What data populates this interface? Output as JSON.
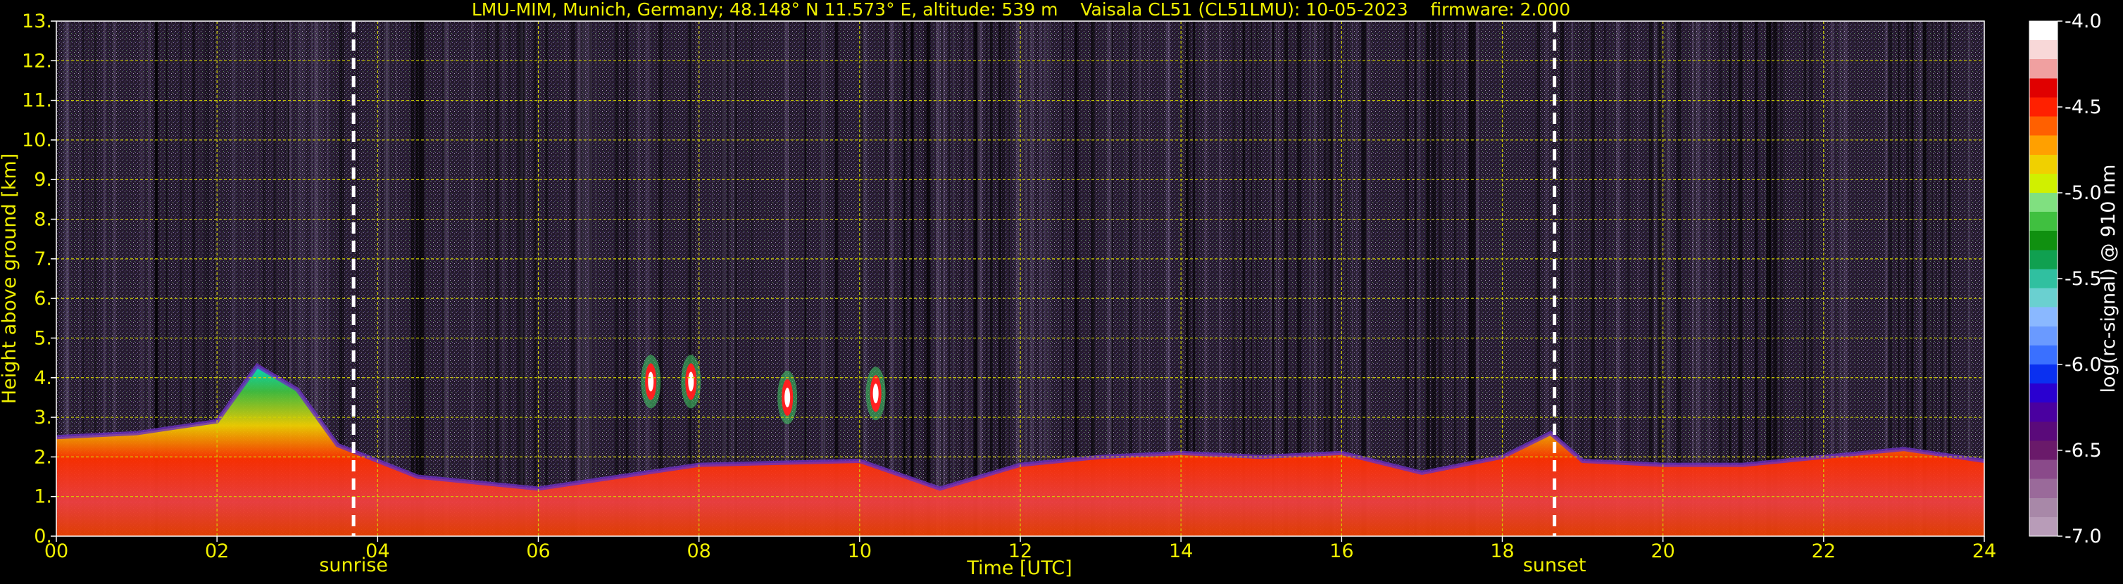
{
  "chart_data": {
    "type": "heatmap",
    "title": "LMU-MIM, Munich, Germany; 48.148° N 11.573° E, altitude: 539 m    Vaisala CL51 (CL51LMU): 10-05-2023    firmware: 2.000",
    "xlabel": "Time [UTC]",
    "ylabel": "Height above ground [km]",
    "xlim": [
      0,
      24
    ],
    "ylim": [
      0,
      13
    ],
    "x_ticks": [
      {
        "value": 0,
        "label": "00"
      },
      {
        "value": 2,
        "label": "02"
      },
      {
        "value": 4,
        "label": "04"
      },
      {
        "value": 6,
        "label": "06"
      },
      {
        "value": 8,
        "label": "08"
      },
      {
        "value": 10,
        "label": "10"
      },
      {
        "value": 12,
        "label": "12"
      },
      {
        "value": 14,
        "label": "14"
      },
      {
        "value": 16,
        "label": "16"
      },
      {
        "value": 18,
        "label": "18"
      },
      {
        "value": 20,
        "label": "20"
      },
      {
        "value": 22,
        "label": "22"
      },
      {
        "value": 24,
        "label": "24"
      }
    ],
    "y_ticks": [
      {
        "value": 0,
        "label": "0."
      },
      {
        "value": 1,
        "label": "1."
      },
      {
        "value": 2,
        "label": "2."
      },
      {
        "value": 3,
        "label": "3."
      },
      {
        "value": 4,
        "label": "4."
      },
      {
        "value": 5,
        "label": "5."
      },
      {
        "value": 6,
        "label": "6."
      },
      {
        "value": 7,
        "label": "7."
      },
      {
        "value": 8,
        "label": "8."
      },
      {
        "value": 9,
        "label": "9."
      },
      {
        "value": 10,
        "label": "10."
      },
      {
        "value": 11,
        "label": "11."
      },
      {
        "value": 12,
        "label": "12."
      },
      {
        "value": 13,
        "label": "13."
      }
    ],
    "grid": true,
    "grid_color": "#d4d400",
    "vlines": [
      {
        "x": 3.7,
        "label": "sunrise"
      },
      {
        "x": 18.65,
        "label": "sunset"
      }
    ],
    "colorbar": {
      "label": "log(rc-signal) @ 910 nm",
      "range": [
        -7.0,
        -4.0
      ],
      "ticks": [
        {
          "value": -4.0,
          "label": "-4.0"
        },
        {
          "value": -4.5,
          "label": "-4.5"
        },
        {
          "value": -5.0,
          "label": "-5.0"
        },
        {
          "value": -5.5,
          "label": "-5.5"
        },
        {
          "value": -6.0,
          "label": "-6.0"
        },
        {
          "value": -6.5,
          "label": "-6.5"
        },
        {
          "value": -7.0,
          "label": "-7.0"
        }
      ],
      "colors": [
        "#b89cb8",
        "#a888a8",
        "#9a6a9a",
        "#8a4a8a",
        "#6a1a6a",
        "#5a0a7a",
        "#4a00a0",
        "#2a00d0",
        "#0a30f0",
        "#3a70ff",
        "#6a9aff",
        "#8ab8ff",
        "#6ad0d0",
        "#30c0a0",
        "#10a050",
        "#109010",
        "#40c040",
        "#80e080",
        "#d0f000",
        "#f0d000",
        "#ffa000",
        "#ff6000",
        "#ff2000",
        "#e00000",
        "#f0a0a0",
        "#f8d8d8",
        "#ffffff"
      ]
    },
    "aerosol_layer_top": [
      {
        "x": 0.0,
        "y": 2.5
      },
      {
        "x": 1.0,
        "y": 2.6
      },
      {
        "x": 2.0,
        "y": 2.9
      },
      {
        "x": 2.5,
        "y": 4.3
      },
      {
        "x": 3.0,
        "y": 3.7
      },
      {
        "x": 3.5,
        "y": 2.3
      },
      {
        "x": 4.5,
        "y": 1.5
      },
      {
        "x": 6.0,
        "y": 1.2
      },
      {
        "x": 8.0,
        "y": 1.8
      },
      {
        "x": 10.0,
        "y": 1.9
      },
      {
        "x": 11.0,
        "y": 1.2
      },
      {
        "x": 12.0,
        "y": 1.8
      },
      {
        "x": 13.0,
        "y": 2.0
      },
      {
        "x": 14.0,
        "y": 2.1
      },
      {
        "x": 15.0,
        "y": 2.0
      },
      {
        "x": 16.0,
        "y": 2.1
      },
      {
        "x": 17.0,
        "y": 1.6
      },
      {
        "x": 18.0,
        "y": 2.0
      },
      {
        "x": 18.6,
        "y": 2.6
      },
      {
        "x": 19.0,
        "y": 1.9
      },
      {
        "x": 20.0,
        "y": 1.8
      },
      {
        "x": 21.0,
        "y": 1.8
      },
      {
        "x": 22.0,
        "y": 2.0
      },
      {
        "x": 23.0,
        "y": 2.2
      },
      {
        "x": 24.0,
        "y": 1.9
      }
    ],
    "cloud_features": [
      {
        "x": 7.4,
        "y": 3.9
      },
      {
        "x": 7.9,
        "y": 3.9
      },
      {
        "x": 9.1,
        "y": 3.5
      },
      {
        "x": 10.2,
        "y": 3.6
      }
    ]
  }
}
